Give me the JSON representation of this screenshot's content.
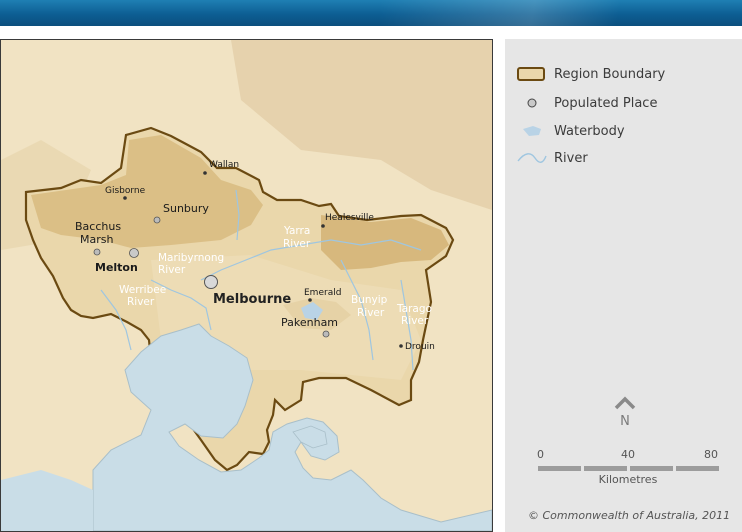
{
  "legend": {
    "items": [
      {
        "label": "Region Boundary",
        "icon": "region-boundary-swatch"
      },
      {
        "label": "Populated Place",
        "icon": "populated-place-dot"
      },
      {
        "label": "Waterbody",
        "icon": "waterbody-swatch"
      },
      {
        "label": "River",
        "icon": "river-line"
      }
    ]
  },
  "map": {
    "places": {
      "wallan": "Wallan",
      "gisborne": "Gisborne",
      "sunbury": "Sunbury",
      "bacchus_marsh_1": "Bacchus",
      "bacchus_marsh_2": "Marsh",
      "melton": "Melton",
      "healesville": "Healesville",
      "melbourne": "Melbourne",
      "emerald": "Emerald",
      "pakenham": "Pakenham",
      "drouin": "Drouin"
    },
    "rivers": {
      "yarra_1": "Yarra",
      "yarra_2": "River",
      "maribyrnong_1": "Maribyrnong",
      "maribyrnong_2": "River",
      "werribee_1": "Werribee",
      "werribee_2": "River",
      "bunyip_1": "Bunyip",
      "bunyip_2": "River",
      "tarago_1": "Tarago",
      "tarago_2": "River"
    },
    "colors": {
      "region_fill": "#e9d5a8",
      "region_border": "#6b4a12",
      "water": "#c9dde7",
      "river": "#9fc6e0",
      "terrain_high": "#c9a867"
    }
  },
  "compass": {
    "north_label": "N"
  },
  "scale": {
    "ticks": [
      "0",
      "40",
      "80"
    ],
    "unit": "Kilometres"
  },
  "footer": {
    "copyright": "© Commonwealth of Australia, 2011"
  }
}
